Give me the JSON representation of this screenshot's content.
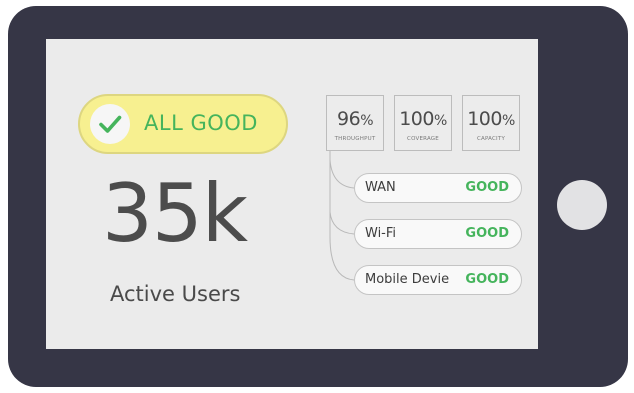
{
  "status_pill": {
    "label": "ALL GOOD",
    "icon": "check-icon",
    "background_color": "#f7f090",
    "text_color": "#45b45c"
  },
  "headline": {
    "value": "35k",
    "caption": "Active Users"
  },
  "metrics": [
    {
      "value": "96",
      "unit": "%",
      "label": "THROUGHPUT"
    },
    {
      "value": "100",
      "unit": "%",
      "label": "COVERAGE"
    },
    {
      "value": "100",
      "unit": "%",
      "label": "CAPACITY"
    }
  ],
  "statuses": [
    {
      "name": "WAN",
      "state": "GOOD"
    },
    {
      "name": "Wi-Fi",
      "state": "GOOD"
    },
    {
      "name": "Mobile Devie",
      "state": "GOOD"
    }
  ],
  "colors": {
    "device_frame": "#363646",
    "screen": "#ebebeb",
    "good": "#45b45c"
  }
}
